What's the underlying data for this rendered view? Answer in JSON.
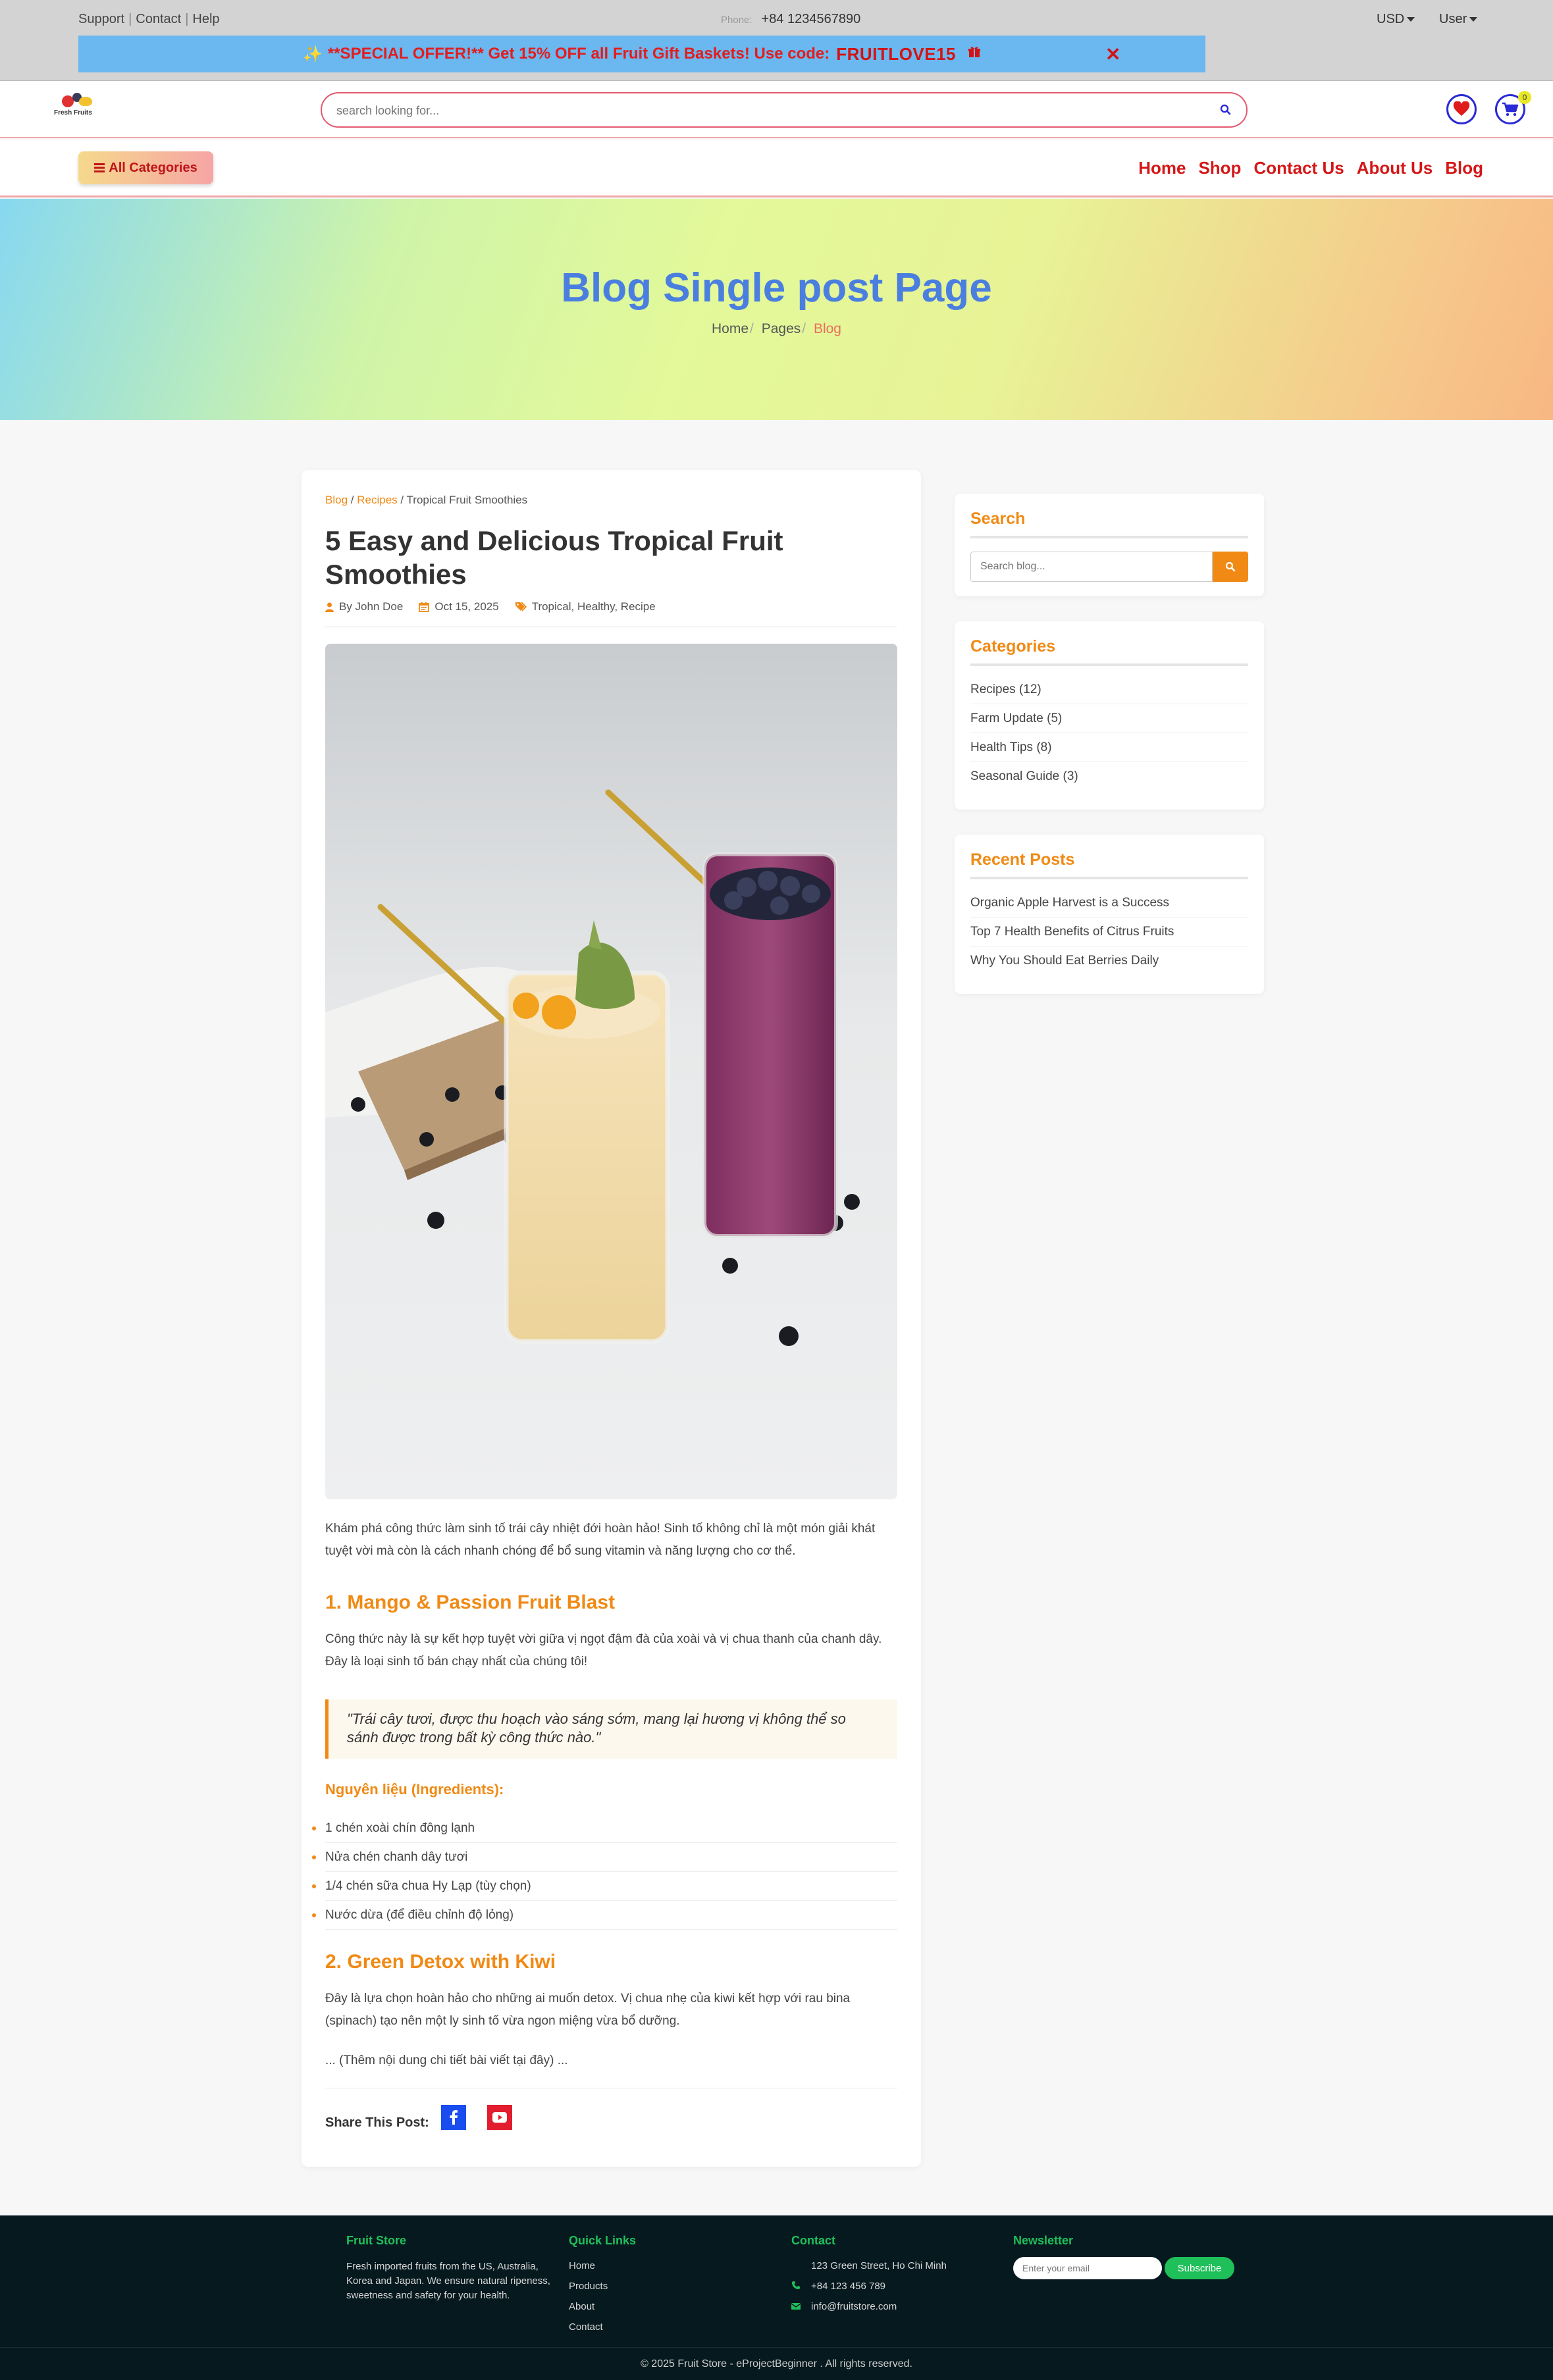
{
  "topbar": {
    "links": [
      "Support",
      "Contact",
      "Help"
    ],
    "separator": "|",
    "phone_label": "Phone:",
    "phone": "+84 1234567890",
    "currency": "USD",
    "user": "User"
  },
  "promo": {
    "sparkle": "✨",
    "text": "**SPECIAL OFFER!** Get 15% OFF all Fruit Gift Baskets! Use code:",
    "code": "FRUITLOVE15",
    "gift_icon": "gift-icon",
    "close": "✕"
  },
  "header": {
    "logo_text": "Fresh Fruits",
    "search_placeholder": "search looking for...",
    "cart_count": "0"
  },
  "nav": {
    "all_categories": "All Categories",
    "menu": [
      "Home",
      "Shop",
      "Contact Us",
      "About Us",
      "Blog"
    ]
  },
  "hero": {
    "title": "Blog Single post Page",
    "crumbs": [
      "Home",
      "Pages",
      "Blog"
    ],
    "crumb_sep": "/"
  },
  "article": {
    "crumbs": [
      "Blog",
      "Recipes",
      "Tropical Fruit Smoothies"
    ],
    "crumb_sep": "/",
    "title": "5 Easy and Delicious Tropical Fruit Smoothies",
    "author": "By John Doe",
    "date": "Oct 15, 2025",
    "tags": "Tropical, Healthy, Recipe",
    "intro": "Khám phá công thức làm sinh tố trái cây nhiệt đới hoàn hảo! Sinh tố không chỉ là một món giải khát tuyệt vời mà còn là cách nhanh chóng để bổ sung vitamin và năng lượng cho cơ thể.",
    "section1_title": "1. Mango & Passion Fruit Blast",
    "section1_text": "Công thức này là sự kết hợp tuyệt vời giữa vị ngọt đậm đà của xoài và vị chua thanh của chanh dây. Đây là loại sinh tố bán chạy nhất của chúng tôi!",
    "quote": "\"Trái cây tươi, được thu hoạch vào sáng sớm, mang lại hương vị không thể so sánh được trong bất kỳ công thức nào.\"",
    "ingredients_title": "Nguyên liệu (Ingredients):",
    "ingredients": [
      "1 chén xoài chín đông lạnh",
      "Nửa chén chanh dây tươi",
      "1/4 chén sữa chua Hy Lạp (tùy chọn)",
      "Nước dừa (để điều chỉnh độ lỏng)"
    ],
    "section2_title": "2. Green Detox with Kiwi",
    "section2_text": "Đây là lựa chọn hoàn hảo cho những ai muốn detox. Vị chua nhẹ của kiwi kết hợp với rau bina (spinach) tạo nên một ly sinh tố vừa ngon miệng vừa bổ dưỡng.",
    "more": "... (Thêm nội dung chi tiết bài viết tại đây) ...",
    "share_label": "Share This Post:"
  },
  "sidebar": {
    "search_title": "Search",
    "search_placeholder": "Search blog...",
    "categories_title": "Categories",
    "categories": [
      "Recipes (12)",
      "Farm Update (5)",
      "Health Tips (8)",
      "Seasonal Guide (3)"
    ],
    "recent_title": "Recent Posts",
    "recent": [
      "Organic Apple Harvest is a Success",
      "Top 7 Health Benefits of Citrus Fruits",
      "Why You Should Eat Berries Daily"
    ]
  },
  "footer": {
    "store_title": "Fruit Store",
    "store_text": "Fresh imported fruits from the US, Australia, Korea and Japan. We ensure natural ripeness, sweetness and safety for your health.",
    "links_title": "Quick Links",
    "links": [
      "Home",
      "Products",
      "About",
      "Contact"
    ],
    "contact_title": "Contact",
    "address": "123 Green Street, Ho Chi Minh",
    "phone": "+84 123 456 789",
    "email": "info@fruitstore.com",
    "newsletter_title": "Newsletter",
    "newsletter_placeholder": "Enter your email",
    "subscribe": "Subscribe",
    "copyright": "© 2025 Fruit Store - eProjectBeginner . All rights reserved."
  },
  "colors": {
    "accent_orange": "#f08a15",
    "nav_red": "#d41717",
    "hero_title": "#4a7fe0",
    "footer_green": "#1fc05a",
    "footer_bg": "#06191f"
  }
}
